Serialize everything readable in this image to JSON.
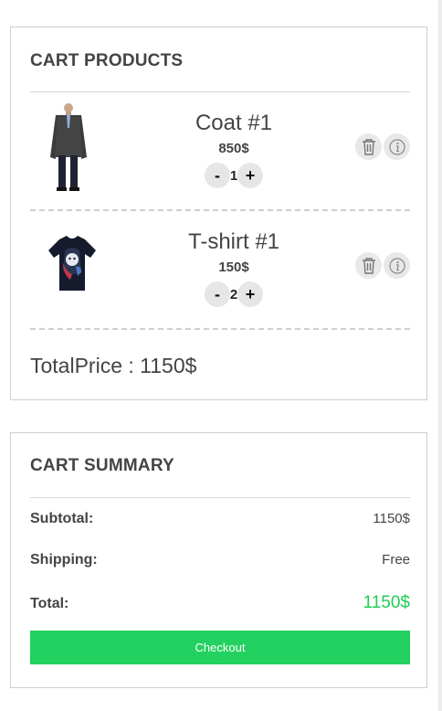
{
  "cart_products": {
    "title": "CART PRODUCTS",
    "items": [
      {
        "name": "Coat #1",
        "price": "850$",
        "quantity": "1",
        "decrement_label": "-",
        "increment_label": "+",
        "image": "coat-thumbnail"
      },
      {
        "name": "T-shirt #1",
        "price": "150$",
        "quantity": "2",
        "decrement_label": "-",
        "increment_label": "+",
        "image": "tshirt-thumbnail"
      }
    ],
    "total_price": "TotalPrice : 1150$"
  },
  "cart_summary": {
    "title": "CART SUMMARY",
    "subtotal_label": "Subtotal:",
    "subtotal_value": "1150$",
    "shipping_label": "Shipping:",
    "shipping_value": "Free",
    "total_label": "Total:",
    "total_value": "1150$",
    "checkout_label": "Checkout"
  },
  "icons": {
    "delete": "trash-icon",
    "details": "info-icon"
  },
  "colors": {
    "accent_green": "#23d160",
    "total_green": "#22cc55",
    "text": "#444444",
    "border": "#cfcfcf"
  }
}
